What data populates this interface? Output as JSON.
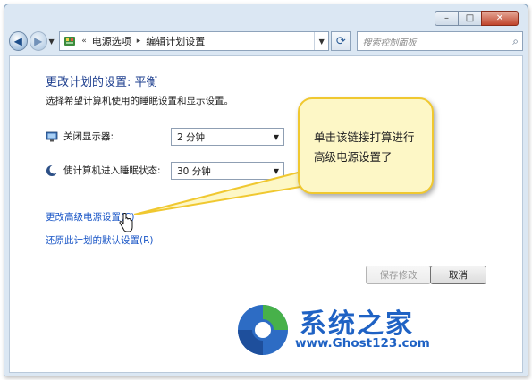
{
  "window": {
    "controls": {
      "minimize": "–",
      "maximize": "□",
      "close": "✕"
    }
  },
  "nav": {
    "back_icon": "back-arrow",
    "breadcrumb_prefix": "«",
    "breadcrumb": [
      "电源选项",
      "编辑计划设置"
    ],
    "breadcrumb_sep": "▸",
    "search_placeholder": "搜索控制面板"
  },
  "content": {
    "title": "更改计划的设置: 平衡",
    "subtitle": "选择希望计算机使用的睡眠设置和显示设置。",
    "settings": [
      {
        "label": "关闭显示器:",
        "value": "2 分钟",
        "icon": "monitor-icon"
      },
      {
        "label": "使计算机进入睡眠状态:",
        "value": "30 分钟",
        "icon": "moon-icon"
      }
    ],
    "links": {
      "advanced": "更改高级电源设置(C)",
      "restore": "还原此计划的默认设置(R)"
    },
    "buttons": {
      "save": "保存修改",
      "cancel": "取消"
    }
  },
  "callout": {
    "text": "单击该链接打算进行高级电源设置了"
  },
  "watermark": {
    "title": "系统之家",
    "url": "www.Ghost123.com"
  },
  "colors": {
    "accent": "#1f62c4",
    "link": "#1b57c7",
    "title": "#1e3f8f",
    "callout_bg": "#fdf7c6",
    "callout_border": "#f0c830"
  }
}
